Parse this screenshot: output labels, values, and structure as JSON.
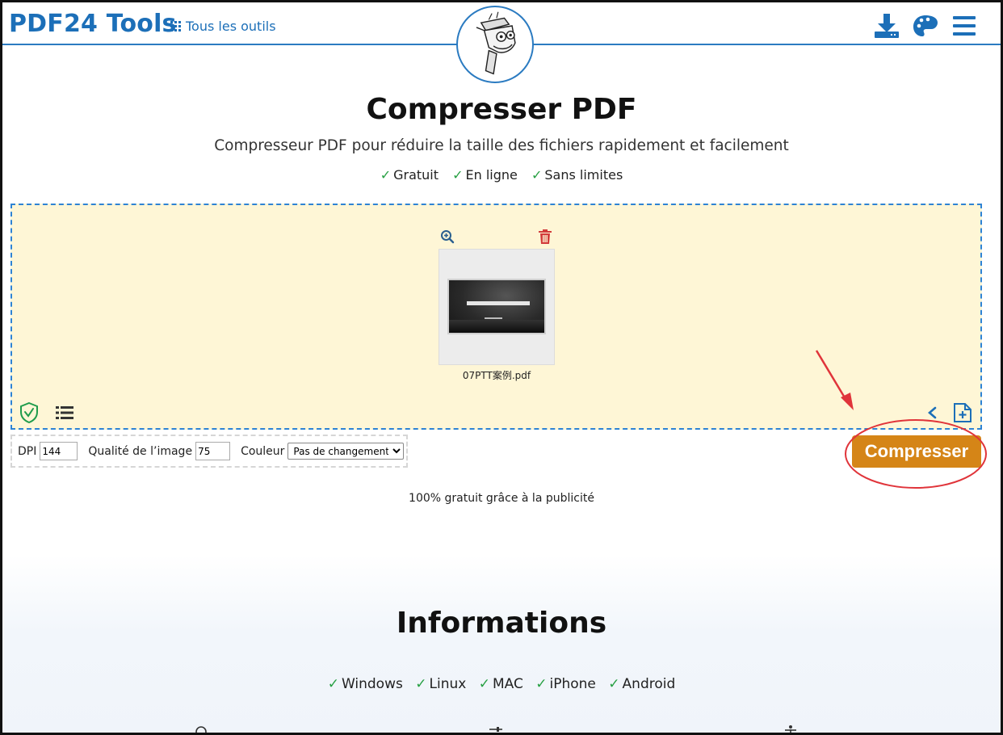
{
  "header": {
    "brand": "PDF24 Tools",
    "all_tools_label": "Tous les outils",
    "icons": [
      "download-icon",
      "palette-icon",
      "menu-icon"
    ],
    "accent_color": "#1c6fb8"
  },
  "hero": {
    "title": "Compresser PDF",
    "subtitle": "Compresseur PDF pour réduire la taille des fichiers rapidement et facilement",
    "features": [
      "Gratuit",
      "En ligne",
      "Sans limites"
    ],
    "check_glyph": "✓"
  },
  "dropzone": {
    "background_color": "#fef6d6",
    "file": {
      "name": "07PTT案例.pdf"
    }
  },
  "options": {
    "dpi_label": "DPI",
    "dpi_value": "144",
    "quality_label": "Qualité de l’image",
    "quality_value": "75",
    "color_label": "Couleur",
    "color_selected": "Pas de changement"
  },
  "actions": {
    "compress_label": "Compresser",
    "button_color": "#d58517"
  },
  "ad_note": "100% gratuit grâce à la publicité",
  "info": {
    "title": "Informations",
    "platforms": [
      "Windows",
      "Linux",
      "MAC",
      "iPhone",
      "Android"
    ]
  }
}
